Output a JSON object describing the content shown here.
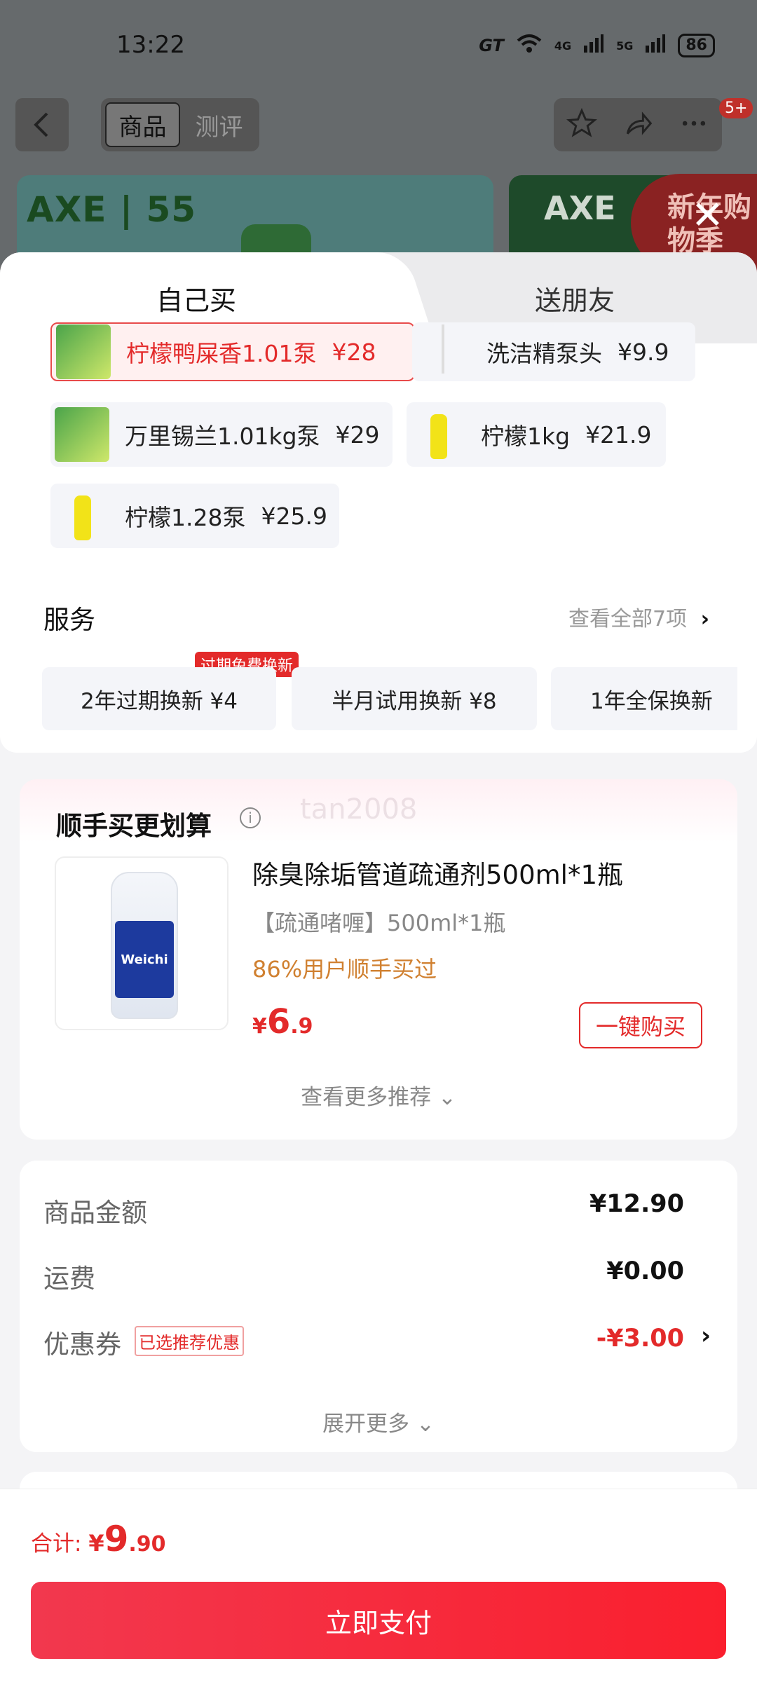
{
  "status_bar": {
    "time": "13:22",
    "network_brand": "GT",
    "sig1": "4G",
    "sig2": "5G",
    "battery": "86"
  },
  "header": {
    "tab_product": "商品",
    "tab_review": "测评",
    "notif_badge": "5+"
  },
  "banner": {
    "brand": "AXE",
    "anniv": "55",
    "promo": "新年购物季"
  },
  "sheet_tabs": {
    "self": "自己买",
    "friend": "送朋友"
  },
  "skus": [
    {
      "name": "柠檬鸭屎香1.01泵",
      "price": "¥28",
      "selected": true
    },
    {
      "name": "洗洁精泵头",
      "price": "¥9.9",
      "selected": false
    },
    {
      "name": "万里锡兰1.01kg泵",
      "price": "¥29",
      "selected": false
    },
    {
      "name": "柠檬1kg",
      "price": "¥21.9",
      "selected": false
    },
    {
      "name": "柠檬1.28泵",
      "price": "¥25.9",
      "selected": false
    }
  ],
  "service": {
    "title": "服务",
    "view_all": "查看全部7项",
    "tag": "过期免费换新",
    "items": [
      "2年过期换新 ¥4",
      "半月试用换新 ¥8",
      "1年全保换新"
    ]
  },
  "upsell": {
    "title": "顺手买更划算",
    "watermark": "tan2008",
    "product_name": "除臭除垢管道疏通剂500ml*1瓶",
    "spec": "【疏通啫喱】500ml*1瓶",
    "stat": "86%用户顺手买过",
    "price_currency": "¥",
    "price_int": "6",
    "price_dec": ".9",
    "product_brand": "Weichi",
    "buy_label": "一键购买",
    "more_label": "查看更多推荐"
  },
  "summary": {
    "goods_label": "商品金额",
    "goods_value": "¥12.90",
    "shipping_label": "运费",
    "shipping_value": "¥0.00",
    "coupon_label": "优惠券",
    "coupon_tag": "已选推荐优惠",
    "coupon_value": "-¥3.00",
    "expand_label": "展开更多"
  },
  "footer": {
    "total_label": "合计: ",
    "currency": "¥",
    "total_int": "9",
    "total_dec": ".90",
    "pay_label": "立即支付"
  },
  "colors": {
    "accent": "#e32a2a",
    "pay_gradient_start": "#f2384e",
    "pay_gradient_end": "#fa1f2e",
    "stat_orange": "#d08030"
  }
}
